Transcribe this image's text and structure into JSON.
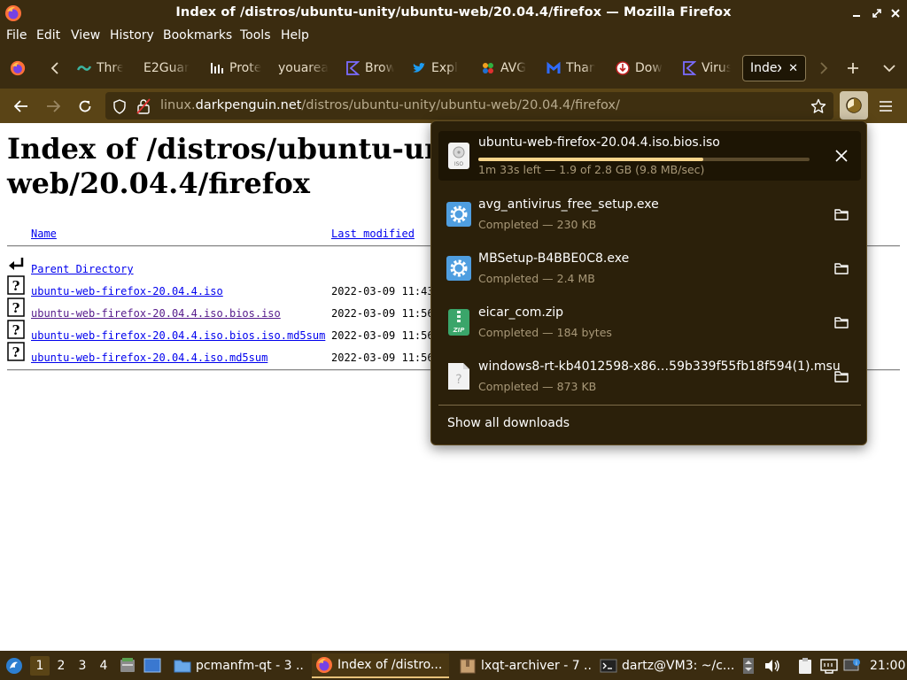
{
  "window": {
    "title": "Index of /distros/ubuntu-unity/ubuntu-web/20.04.4/firefox — Mozilla Firefox"
  },
  "menu": [
    "File",
    "Edit",
    "View",
    "History",
    "Bookmarks",
    "Tools",
    "Help"
  ],
  "tabs": [
    {
      "label": "Thre",
      "icon": "threat-favicon-icon"
    },
    {
      "label": "E2Guar",
      "icon": "none"
    },
    {
      "label": "Prote",
      "icon": "chart-favicon-icon"
    },
    {
      "label": "youarea",
      "icon": "none"
    },
    {
      "label": "Brow",
      "icon": "bracket-favicon-icon"
    },
    {
      "label": "Expl",
      "icon": "twitter-favicon-icon"
    },
    {
      "label": "AVG",
      "icon": "avg-favicon-icon"
    },
    {
      "label": "Than",
      "icon": "malwarebytes-favicon-icon"
    },
    {
      "label": "Dow",
      "icon": "download-favicon-icon"
    },
    {
      "label": "Virus",
      "icon": "virustotal-favicon-icon"
    },
    {
      "label": "Index",
      "icon": "none",
      "active": true
    }
  ],
  "address": {
    "prefix": "linux.",
    "host": "darkpenguin.net",
    "path": "/distros/ubuntu-unity/ubuntu-web/20.04.4/firefox/"
  },
  "page": {
    "heading": "Index of /distros/ubuntu-unity/ubuntu-web/20.04.4/firefox",
    "columns": {
      "name": "Name",
      "modified": "Last modified"
    },
    "parent": "Parent Directory",
    "rows": [
      {
        "name": "ubuntu-web-firefox-20.04.4.iso",
        "date": "2022-03-09 11:43",
        "visited": false
      },
      {
        "name": "ubuntu-web-firefox-20.04.4.iso.bios.iso",
        "date": "2022-03-09 11:56",
        "visited": true
      },
      {
        "name": "ubuntu-web-firefox-20.04.4.iso.bios.iso.md5sum",
        "date": "2022-03-09 11:56",
        "visited": false
      },
      {
        "name": "ubuntu-web-firefox-20.04.4.iso.md5sum",
        "date": "2022-03-09 11:56",
        "visited": false
      }
    ]
  },
  "downloads": {
    "items": [
      {
        "name": "ubuntu-web-firefox-20.04.4.iso.bios.iso",
        "status": "1m 33s left — 1.9 of 2.8 GB (9.8 MB/sec)",
        "progress": 0.68,
        "icon": "iso-file-icon",
        "action": "cancel-icon",
        "icon_label": "ISO"
      },
      {
        "name": "avg_antivirus_free_setup.exe",
        "status": "Completed — 230 KB",
        "icon": "exe-gear-icon",
        "action": "folder-icon"
      },
      {
        "name": "MBSetup-B4BBE0C8.exe",
        "status": "Completed — 2.4 MB",
        "icon": "exe-gear-icon",
        "action": "folder-icon"
      },
      {
        "name": "eicar_com.zip",
        "status": "Completed — 184 bytes",
        "icon": "zip-file-icon",
        "action": "folder-icon",
        "icon_label": "ZIP"
      },
      {
        "name": "windows8-rt-kb4012598-x86…59b339f55fb18f594(1).msu",
        "status": "Completed — 873 KB",
        "icon": "unknown-file-icon",
        "action": "folder-icon"
      }
    ],
    "show_all": "Show all downloads"
  },
  "taskbar": {
    "desktops": [
      "1",
      "2",
      "3",
      "4"
    ],
    "tasks": [
      {
        "label": "pcmanfm-qt - 3 ...",
        "icon": "folder-icon"
      },
      {
        "label": "Index of /distro...",
        "icon": "firefox-icon",
        "active": true
      },
      {
        "label": "lxqt-archiver - 7 ...",
        "icon": "archive-icon"
      },
      {
        "label": "dartz@VM3: ~/c...",
        "icon": "terminal-icon"
      }
    ],
    "clock": "21:00"
  },
  "colors": {
    "chrome": "#3b2c10",
    "navbar": "#5a4416",
    "panel": "#2b200a",
    "progress": "#f6d48a"
  }
}
